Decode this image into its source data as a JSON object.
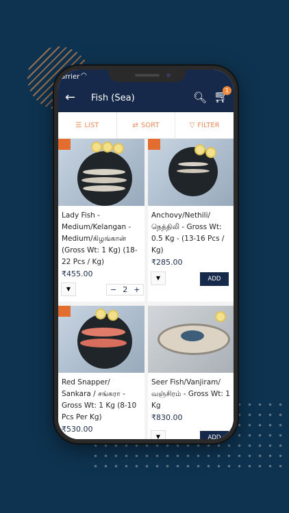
{
  "status": {
    "carrier": "arrier"
  },
  "appbar": {
    "title": "Fish (Sea)",
    "cart_count": "1"
  },
  "toolbar": {
    "list": "LIST",
    "sort": "SORT",
    "filter": "FILTER"
  },
  "products": [
    {
      "name": "Lady Fish - Medium/Kelangan - Medium/கிழங்கான் (Gross Wt: 1 Kg) (18-22 Pcs / Kg)",
      "price": "₹455.00",
      "quantity": "2"
    },
    {
      "name": "Anchovy/Nethili/ நெத்திலி - Gross Wt: 0.5 Kg - (13-16 Pcs / Kg)",
      "price": "₹285.00",
      "button": "ADD"
    },
    {
      "name": "Red Snapper/ Sankara / சங்கரா - Gross Wt: 1 Kg (8-10 Pcs Per Kg)",
      "price": "₹530.00"
    },
    {
      "name": "Seer Fish/Vanjiram/ வஞ்சிரம் - Gross Wt: 1 Kg",
      "price": "₹830.00",
      "button": "ADD"
    }
  ],
  "icons": {
    "back": "arrow-left-icon",
    "search": "search-icon",
    "cart": "cart-icon",
    "list": "list-icon",
    "sort": "sort-icon",
    "filter": "filter-icon",
    "dropdown": "chevron-down-icon"
  },
  "colors": {
    "background": "#0e3350",
    "appbar": "#17294a",
    "accent": "#e88b5a",
    "badge": "#f08a3c"
  }
}
